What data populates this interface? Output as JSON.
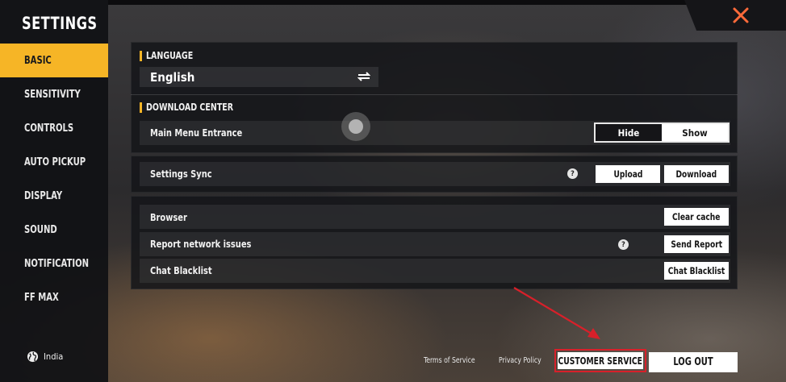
{
  "sidebar": {
    "title": "SETTINGS",
    "items": [
      {
        "label": "BASIC",
        "active": true
      },
      {
        "label": "SENSITIVITY"
      },
      {
        "label": "CONTROLS"
      },
      {
        "label": "AUTO PICKUP"
      },
      {
        "label": "DISPLAY"
      },
      {
        "label": "SOUND"
      },
      {
        "label": "NOTIFICATION"
      },
      {
        "label": "FF MAX"
      }
    ],
    "region": "India",
    "region_icon": "globe-icon"
  },
  "close_icon": "close-icon",
  "accent_color": "#f6b526",
  "language": {
    "header": "LANGUAGE",
    "value": "English",
    "icon": "swap-icon"
  },
  "download_center": {
    "header": "DOWNLOAD CENTER",
    "main_menu_entrance": {
      "label": "Main Menu Entrance",
      "options": [
        "Hide",
        "Show"
      ],
      "selected": "Show"
    }
  },
  "settings_sync": {
    "label": "Settings Sync",
    "help_icon": "help-icon",
    "upload_label": "Upload",
    "download_label": "Download"
  },
  "misc": {
    "browser_label": "Browser",
    "clear_cache_label": "Clear cache",
    "report_label": "Report network issues",
    "send_report_label": "Send Report",
    "blacklist_label": "Chat Blacklist",
    "blacklist_button": "Chat Blacklist"
  },
  "footer": {
    "terms": "Terms of Service",
    "privacy": "Privacy Policy",
    "customer_service": "CUSTOMER SERVICE",
    "logout": "LOG OUT"
  },
  "annotation": {
    "highlight_color": "#d8202a"
  }
}
